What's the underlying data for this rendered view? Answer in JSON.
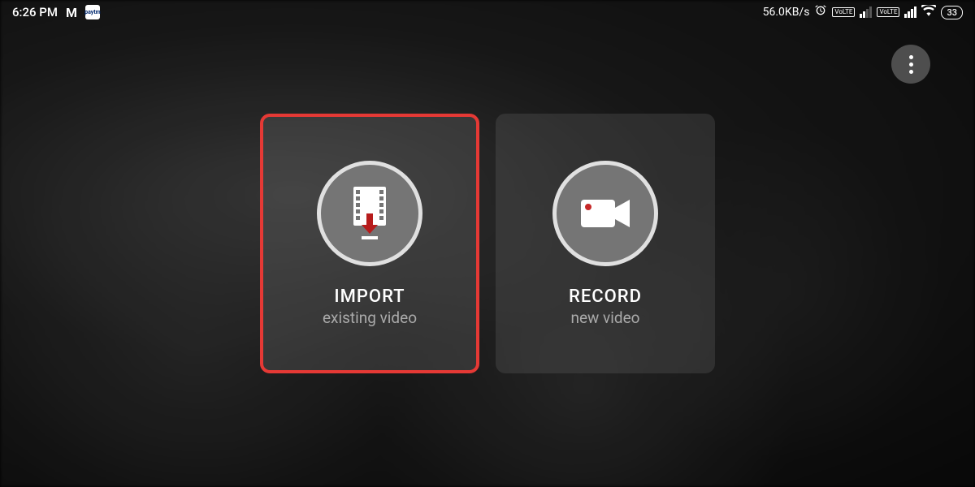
{
  "statusBar": {
    "time": "6:26 PM",
    "appIcon1": "M",
    "appIcon2": "paytm",
    "netSpeed": "56.0KB/s",
    "volte": "VoLTE",
    "battery": "33"
  },
  "cards": {
    "import": {
      "title": "IMPORT",
      "subtitle": "existing video"
    },
    "record": {
      "title": "RECORD",
      "subtitle": "new video"
    }
  }
}
